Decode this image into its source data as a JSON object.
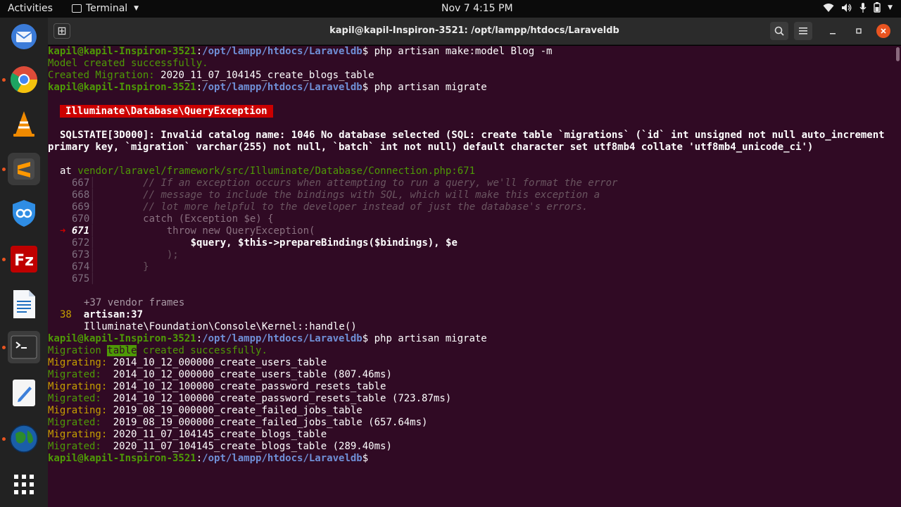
{
  "topbar": {
    "activities": "Activities",
    "app_name": "Terminal",
    "clock": "Nov 7  4:15 PM"
  },
  "dock": {
    "items": [
      {
        "name": "thunderbird-icon",
        "color": "#3b7bd8"
      },
      {
        "name": "chrome-icon",
        "color": "#dd4b39"
      },
      {
        "name": "vlc-icon",
        "color": "#f08a00"
      },
      {
        "name": "sublime-icon",
        "color": "#ff9800"
      },
      {
        "name": "vpn-icon",
        "color": "#2f8de4"
      },
      {
        "name": "filezilla-icon",
        "color": "#bf0000"
      },
      {
        "name": "writer-icon",
        "color": "#1f6fbf"
      },
      {
        "name": "terminal-icon",
        "color": "#2c2c2c"
      },
      {
        "name": "text-editor-icon",
        "color": "#3d7fd9"
      },
      {
        "name": "globe-icon",
        "color": "#2c8c2c"
      },
      {
        "name": "show-apps-icon",
        "color": "#ffffff"
      }
    ]
  },
  "window": {
    "title": "kapil@kapil-Inspiron-3521: /opt/lampp/htdocs/Laraveldb"
  },
  "terminal": {
    "user_host": "kapil@kapil-Inspiron-3521",
    "path": "/opt/lampp/htdocs/Laraveldb",
    "cmd1": "php artisan make:model Blog -m",
    "out1": "Model created successfully.",
    "out2_label": "Created Migration:",
    "out2_value": "2020_11_07_104145_create_blogs_table",
    "cmd2": "php artisan migrate",
    "exception_name": "Illuminate\\Database\\QueryException",
    "sqlstate_1": "SQLSTATE[3D000]: Invalid catalog name: 1046 No database selected (SQL: create table `migrations` (`id` int unsigned not null auto_increment",
    "sqlstate_2": "primary key, `migration` varchar(255) not null, `batch` int not null) default character set utf8mb4 collate 'utf8mb4_unicode_ci')",
    "at_label": "at",
    "at_path": "vendor/laravel/framework/src/Illuminate/Database/Connection.php:671",
    "code": [
      {
        "num": "667",
        "text": "        // If an exception occurs when attempting to run a query, we'll format the error"
      },
      {
        "num": "668",
        "text": "        // message to include the bindings with SQL, which will make this exception a"
      },
      {
        "num": "669",
        "text": "        // lot more helpful to the developer instead of just the database's errors."
      },
      {
        "num": "670",
        "text": "        catch (Exception $e) {"
      },
      {
        "num": "671",
        "text": "            throw new QueryException("
      },
      {
        "num": "672",
        "text": "                $query, $this->prepareBindings($bindings), $e"
      },
      {
        "num": "673",
        "text": "            );"
      },
      {
        "num": "674",
        "text": "        }"
      },
      {
        "num": "675",
        "text": ""
      }
    ],
    "vendor_frames": "+37 vendor frames",
    "frame38_num": "38",
    "frame38_text": "artisan:37",
    "frame38_call": "Illuminate\\Foundation\\Console\\Kernel::handle()",
    "cmd3": "php artisan migrate",
    "mig_table_pre": "Migration ",
    "mig_table_hl": "table",
    "mig_table_post": " created successfully.",
    "migrations": [
      {
        "label": "Migrating:",
        "value": "2014_10_12_000000_create_users_table"
      },
      {
        "label": "Migrated: ",
        "value": "2014_10_12_000000_create_users_table (807.46ms)"
      },
      {
        "label": "Migrating:",
        "value": "2014_10_12_100000_create_password_resets_table"
      },
      {
        "label": "Migrated: ",
        "value": "2014_10_12_100000_create_password_resets_table (723.87ms)"
      },
      {
        "label": "Migrating:",
        "value": "2019_08_19_000000_create_failed_jobs_table"
      },
      {
        "label": "Migrated: ",
        "value": "2019_08_19_000000_create_failed_jobs_table (657.64ms)"
      },
      {
        "label": "Migrating:",
        "value": "2020_11_07_104145_create_blogs_table"
      },
      {
        "label": "Migrated: ",
        "value": "2020_11_07_104145_create_blogs_table (289.40ms)"
      }
    ]
  }
}
